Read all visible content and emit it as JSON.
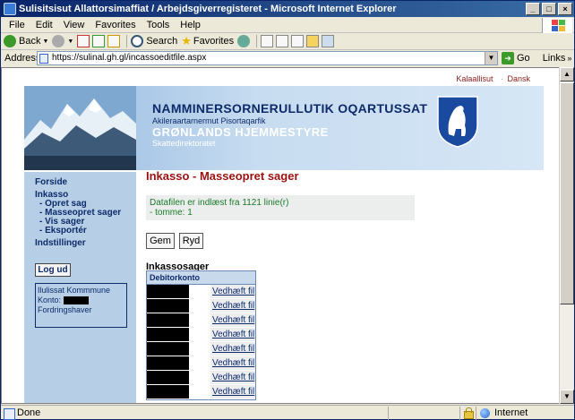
{
  "window": {
    "title": "Sulisitsisut Allattorsimaffiat / Arbejdsgiverregisteret - Microsoft Internet Explorer"
  },
  "menu": [
    "File",
    "Edit",
    "View",
    "Favorites",
    "Tools",
    "Help"
  ],
  "toolbar": {
    "back": "Back",
    "search": "Search",
    "favorites": "Favorites"
  },
  "address": {
    "label": "Address",
    "url": "https://sulinal.gh.gl/incassoeditfile.aspx",
    "go": "Go",
    "links": "Links"
  },
  "page": {
    "languages": [
      "Kalaallisut",
      "Dansk"
    ],
    "banner": {
      "line1": "NAMMINERSORNERULLUTIK OQARTUSSAT",
      "line2": "Akileraartarnermut Pisortaqarfik",
      "line3": "GRØNLANDS HJEMMESTYRE",
      "line4": "Skattedirektoratet"
    },
    "nav": {
      "forside": "Forside",
      "inkasso": "Inkasso",
      "opret": "- Opret sag",
      "masseopret": "- Masseopret sager",
      "vis": "- Vis sager",
      "eksporter": "- Eksportér",
      "indstillinger": "Indstillinger",
      "logout": "Log ud"
    },
    "account": {
      "company": "Ilulissat Kommmune",
      "konto_label": "Konto:",
      "role": "Fordringshaver"
    },
    "title": "Inkasso - Masseopret sager",
    "message": {
      "line1": "Datafilen er indlæst fra 1121 linie(r)",
      "line2": "- tomme: 1"
    },
    "buttons": {
      "save": "Gem",
      "undo": "Ryd"
    },
    "section_title": "Inkassosager",
    "table": {
      "header": "Debitorkonto",
      "rows": [
        "Vedhæft fil",
        "Vedhæft fil",
        "Vedhæft fil",
        "Vedhæft fil",
        "Vedhæft fil",
        "Vedhæft fil",
        "Vedhæft fil",
        "Vedhæft fil"
      ]
    }
  },
  "status": {
    "text": "Done",
    "zone": "Internet"
  }
}
